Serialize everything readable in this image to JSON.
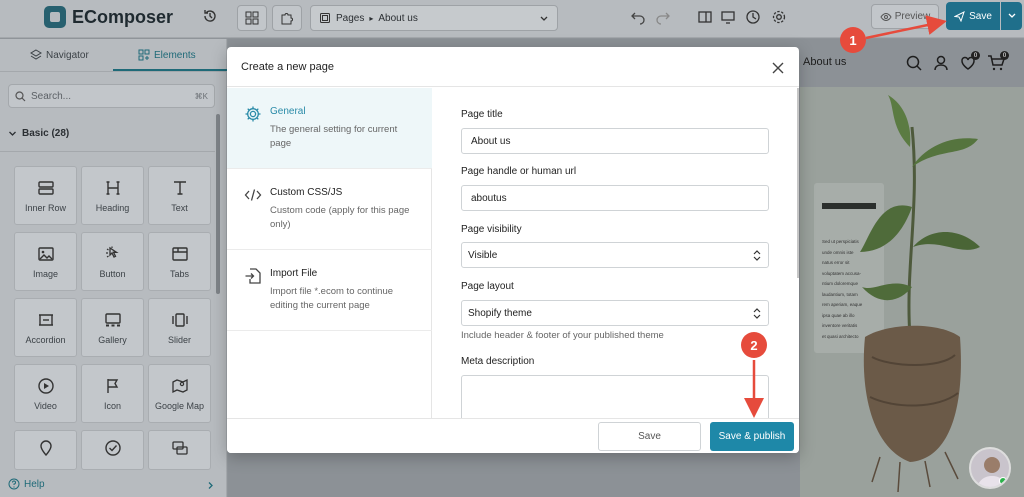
{
  "app": {
    "brand": "EComposer"
  },
  "toolbar": {
    "page_select": {
      "root": "Pages",
      "current": "About us"
    },
    "preview_label": "Preview",
    "save_label": "Save"
  },
  "left_panel": {
    "tabs": [
      {
        "label": "Navigator",
        "icon": "layers-icon",
        "active": false
      },
      {
        "label": "Elements",
        "icon": "elements-icon",
        "active": true
      }
    ],
    "search": {
      "placeholder": "Search...",
      "shortcut": "⌘K"
    },
    "category": "Basic (28)",
    "elements": [
      {
        "label": "Inner Row",
        "icon": "inner-row-icon"
      },
      {
        "label": "Heading",
        "icon": "heading-icon"
      },
      {
        "label": "Text",
        "icon": "text-icon"
      },
      {
        "label": "Image",
        "icon": "image-icon"
      },
      {
        "label": "Button",
        "icon": "button-icon"
      },
      {
        "label": "Tabs",
        "icon": "tabs-icon"
      },
      {
        "label": "Accordion",
        "icon": "accordion-icon"
      },
      {
        "label": "Gallery",
        "icon": "gallery-icon"
      },
      {
        "label": "Slider",
        "icon": "slider-icon"
      },
      {
        "label": "Video",
        "icon": "video-icon"
      },
      {
        "label": "Icon",
        "icon": "flag-icon"
      },
      {
        "label": "Google Map",
        "icon": "map-icon"
      },
      {
        "label": "",
        "icon": "location-pin-icon"
      },
      {
        "label": "",
        "icon": "check-circle-icon"
      },
      {
        "label": "",
        "icon": "chat-icon"
      }
    ],
    "help_label": "Help"
  },
  "canvas": {
    "store_nav_link": "About us",
    "wishlist_count": "0",
    "cart_count": "0",
    "hero_text_lines": [
      "Sed ut perspiciatis",
      "unde omnis iste",
      "natus error sit",
      "voluptatem accusa-",
      "ntium doloremque",
      "laudantium, totam",
      "rem aperiam, eaque",
      "ipsa quae ab illo",
      "inventore veritatis",
      "et quasi architecto"
    ]
  },
  "modal": {
    "title": "Create a new page",
    "nav": [
      {
        "title": "General",
        "desc": "The general setting for current page",
        "icon": "gear-icon",
        "active": true
      },
      {
        "title": "Custom CSS/JS",
        "desc": "Custom code (apply for this page only)",
        "icon": "code-icon",
        "active": false
      },
      {
        "title": "Import File",
        "desc": "Import file *.ecom to continue editing the current page",
        "icon": "import-file-icon",
        "active": false
      }
    ],
    "fields": {
      "page_title_label": "Page title",
      "page_title_value": "About us",
      "handle_label": "Page handle or human url",
      "handle_value": "aboutus",
      "visibility_label": "Page visibility",
      "visibility_value": "Visible",
      "layout_label": "Page layout",
      "layout_value": "Shopify theme",
      "layout_hint": "Include header & footer of your published theme",
      "meta_label": "Meta description"
    },
    "save_label": "Save",
    "publish_label": "Save & publish"
  },
  "annotations": {
    "step1": "1",
    "step2": "2",
    "color": "#e64b3c"
  }
}
